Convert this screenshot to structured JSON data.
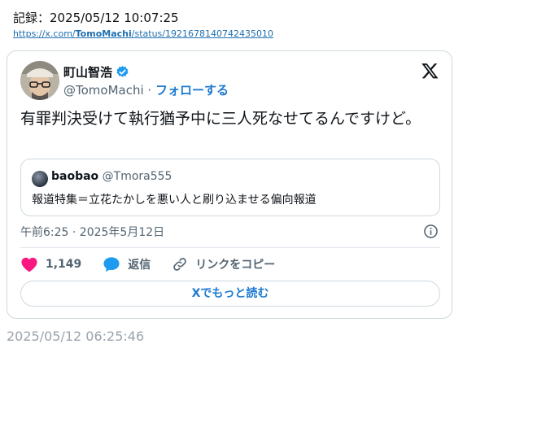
{
  "record": {
    "label": "記録：2025/05/12 10:07:25"
  },
  "source_url": {
    "prefix": "https://x.com/",
    "user": "TomoMachi",
    "suffix": "/status/1921678140742435010"
  },
  "tweet": {
    "author_name": "町山智浩",
    "author_handle": "@TomoMachi",
    "separator": " · ",
    "follow_label": "フォローする",
    "text": "有罪判決受けて執行猶予中に三人死なせてるんですけど。",
    "timestamp": "午前6:25 · 2025年5月12日",
    "likes": "1,149",
    "reply_label": "返信",
    "copy_link_label": "リンクをコピー",
    "read_more_label": "Xでもっと読む"
  },
  "quote": {
    "author_name": "baobao",
    "author_handle": "@Tmora555",
    "text": "報道特集＝立花たかしを悪い人と刷り込ませる偏向報道"
  },
  "footer": {
    "saved_time": "2025/05/12 06:25:46"
  },
  "colors": {
    "accent": "#1d9bf0",
    "like": "#f91880",
    "link": "#1f6fb0",
    "muted": "#536471",
    "border": "#cfd9de"
  },
  "icons": [
    "verified-badge-icon",
    "x-logo-icon",
    "info-icon",
    "heart-icon",
    "reply-bubble-icon",
    "link-icon"
  ]
}
